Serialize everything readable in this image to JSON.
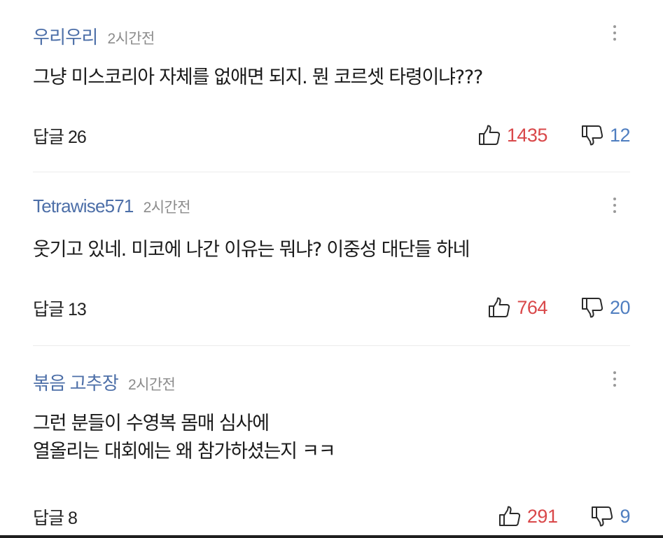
{
  "comments": [
    {
      "author": "우리우리",
      "time": "2시간전",
      "lines": [
        "그냥 미스코리아 자체를 없애면 되지. 뭔 코르셋 타령이냐???"
      ],
      "reply_label": "답글 26",
      "likes": "1435",
      "dislikes": "12"
    },
    {
      "author": "Tetrawise571",
      "time": "2시간전",
      "lines": [
        "웃기고 있네. 미코에 나간 이유는 뭐냐? 이중성 대단들 하네"
      ],
      "reply_label": "답글 13",
      "likes": "764",
      "dislikes": "20"
    },
    {
      "author": "볶음 고추장",
      "time": "2시간전",
      "lines": [
        "그런 분들이 수영복 몸매 심사에",
        "열올리는 대회에는 왜 참가하셨는지 ㅋㅋ"
      ],
      "reply_label": "답글 8",
      "likes": "291",
      "dislikes": "9"
    }
  ],
  "icons": {
    "more": "more-vertical-icon",
    "like": "thumbs-up-icon",
    "dislike": "thumbs-down-icon"
  },
  "colors": {
    "author": "#4d6fa8",
    "like_count": "#d9484a",
    "dislike_count": "#4f7ec0",
    "time": "#8c8c8c"
  }
}
